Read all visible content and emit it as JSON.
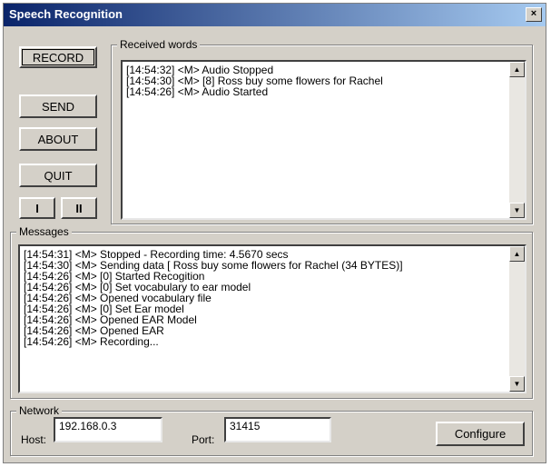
{
  "window": {
    "title": "Speech Recognition",
    "close_glyph": "×"
  },
  "buttons": {
    "record": "RECORD",
    "send": "SEND",
    "about": "ABOUT",
    "quit": "QUIT",
    "small1": "I",
    "small2": "II",
    "configure": "Configure"
  },
  "received": {
    "label": "Received words",
    "lines": [
      "[14:54:32] <M> Audio Stopped",
      "[14:54:30] <M> [8]  Ross buy some flowers for Rachel",
      "[14:54:26] <M> Audio Started"
    ]
  },
  "messages": {
    "label": "Messages",
    "lines": [
      "[14:54:31] <M> Stopped - Recording time:   4.5670 secs",
      "[14:54:30] <M> Sending data [ Ross buy some flowers for Rachel  (34 BYTES)]",
      "[14:54:26] <M> [0] Started Recogition",
      "[14:54:26] <M> [0] Set vocabulary to ear model",
      "[14:54:26] <M> Opened vocabulary file",
      "[14:54:26] <M> [0] Set Ear model",
      "[14:54:26] <M> Opened EAR Model",
      "[14:54:26] <M> Opened EAR",
      "[14:54:26] <M> Recording..."
    ]
  },
  "network": {
    "label": "Network",
    "host_label": "Host:",
    "host_value": "192.168.0.3",
    "port_label": "Port:",
    "port_value": "31415"
  }
}
